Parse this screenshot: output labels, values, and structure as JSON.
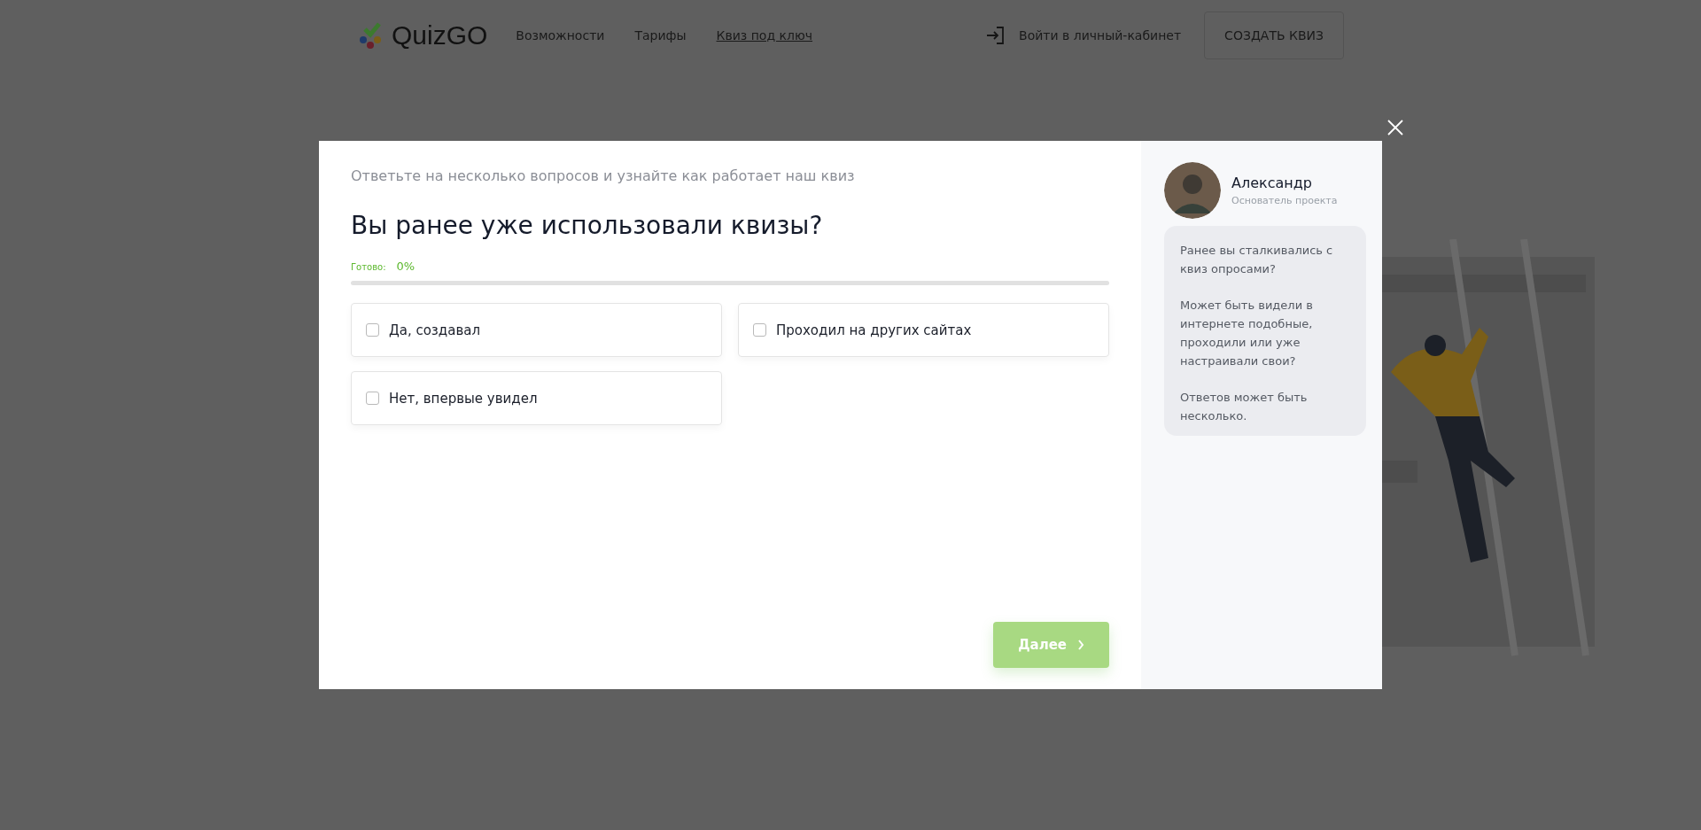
{
  "header": {
    "logo": "QuizGO",
    "nav": [
      {
        "label": "Возможности",
        "selected": false
      },
      {
        "label": "Тарифы",
        "selected": false
      },
      {
        "label": "Квиз под ключ",
        "selected": true
      }
    ],
    "login": "Войти в личный-кабинет",
    "create_button": "СОЗДАТЬ КВИЗ"
  },
  "quiz": {
    "subtitle": "Ответьте на несколько вопросов и узнайте как работает наш квиз",
    "question": "Вы ранее уже использовали квизы?",
    "progress": {
      "label": "Готово:",
      "value": "0%",
      "level": 0
    },
    "options": [
      {
        "label": "Да, создавал",
        "checked": false
      },
      {
        "label": "Проходил на других сайтах",
        "checked": false
      },
      {
        "label": "Нет, впервые увидел",
        "checked": false
      }
    ],
    "next_button": {
      "label": "Далее",
      "disabled": true
    }
  },
  "assistant": {
    "name": "Александр",
    "role": "Основатель проекта",
    "messages": [
      "Ранее вы сталкивались с квиз опросами?",
      "Может быть видели в интернете подобные, проходили или уже настраивали свои?",
      "Ответов может быть несколько."
    ]
  }
}
